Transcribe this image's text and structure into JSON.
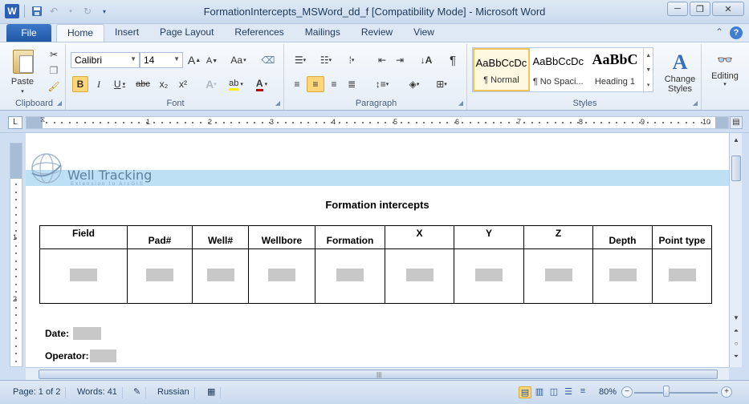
{
  "window": {
    "title": "FormationIntercepts_MSWord_dd_f [Compatibility Mode]  -  Microsoft Word",
    "app_icon": "W",
    "controls": [
      "minimize",
      "restore",
      "close"
    ]
  },
  "ribbon_tabs": {
    "file": "File",
    "tabs": [
      "Home",
      "Insert",
      "Page Layout",
      "References",
      "Mailings",
      "Review",
      "View"
    ],
    "active": "Home"
  },
  "clipboard": {
    "paste_label": "Paste",
    "group_label": "Clipboard"
  },
  "font": {
    "name": "Calibri",
    "size": "14",
    "group_label": "Font",
    "buttons": {
      "bold": "B",
      "italic": "I",
      "underline": "U",
      "strike": "abc",
      "subscript": "x₂",
      "superscript": "x²",
      "grow": "A",
      "shrink": "A",
      "case": "Aa"
    }
  },
  "paragraph": {
    "group_label": "Paragraph",
    "pilcrow": "¶"
  },
  "styles": {
    "group_label": "Styles",
    "items": [
      {
        "sample": "AaBbCcDc",
        "name": "¶ Normal"
      },
      {
        "sample": "AaBbCcDc",
        "name": "¶ No Spaci..."
      },
      {
        "sample": "AaBbC",
        "name": "Heading 1"
      }
    ],
    "change_styles": "Change Styles"
  },
  "editing": {
    "label": "Editing"
  },
  "ruler": {
    "numbers": [
      "1",
      "2",
      "3",
      "4",
      "5",
      "6",
      "7",
      "8",
      "9",
      "10",
      "11"
    ],
    "end_label": "11"
  },
  "vruler": {
    "numbers": [
      "1",
      "2"
    ]
  },
  "document": {
    "logo_text": "Well Tracking",
    "logo_subtext": "Extension to ArcGIS",
    "title": "Formation intercepts",
    "table_headers": [
      "Field",
      "Pad#",
      "Well#",
      "Wellbore",
      "Formation",
      "X",
      "Y",
      "Z",
      "Depth",
      "Point type"
    ],
    "date_label": "Date:",
    "operator_label": "Operator:"
  },
  "statusbar": {
    "page": "Page: 1 of 2",
    "words": "Words: 41",
    "language": "Russian",
    "zoom": "80%",
    "zoom_value": 0.8
  },
  "colors": {
    "accent": "#2b5fb4",
    "header_band": "#bde0f5",
    "field_placeholder": "#c8c8c8",
    "active_button": "#ffd77a"
  }
}
